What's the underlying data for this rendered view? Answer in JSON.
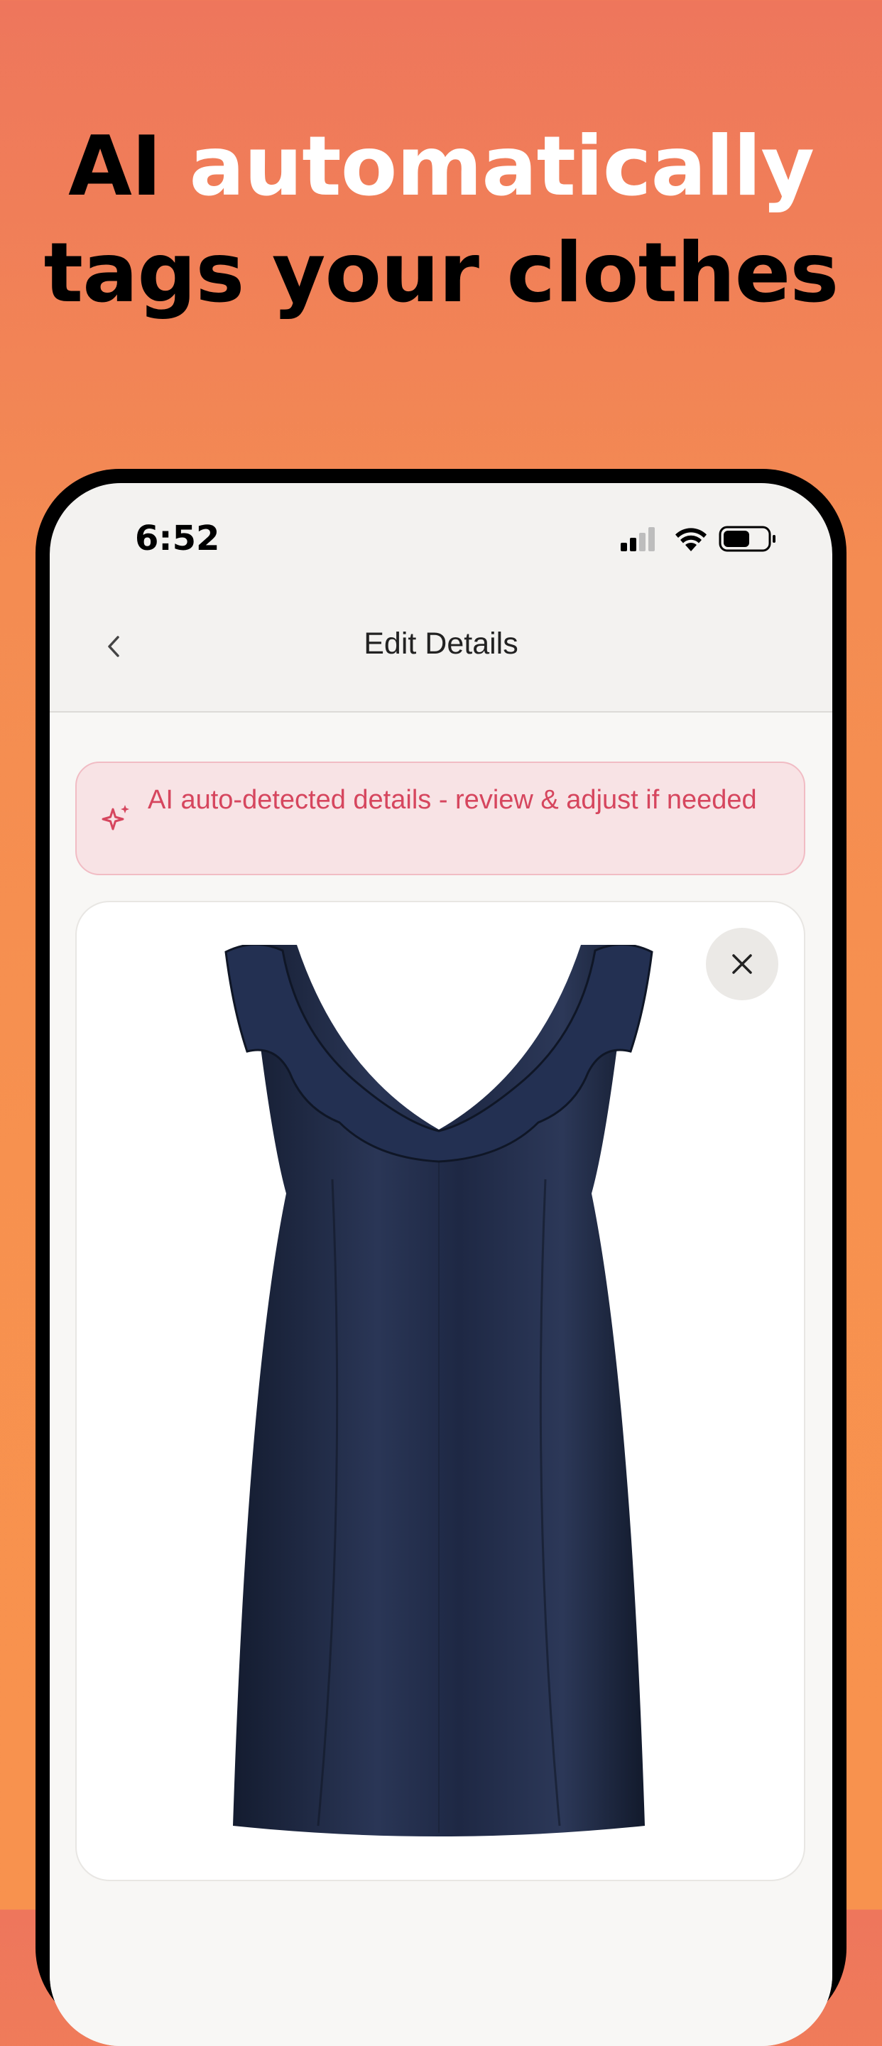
{
  "headline": {
    "part1": "AI ",
    "part2": "automatically",
    "part3": "tags your clothes"
  },
  "status_bar": {
    "time": "6:52",
    "icons": [
      "cellular-signal-icon",
      "wifi-icon",
      "battery-icon"
    ]
  },
  "nav": {
    "title": "Edit Details",
    "back_icon": "chevron-left-icon"
  },
  "banner": {
    "icon": "sparkle-icon",
    "text": "AI auto-detected details - review & adjust if needed"
  },
  "item_card": {
    "image_icon": "navy-satin-ruffle-dress",
    "close_icon": "close-icon"
  },
  "colors": {
    "background_top": "#ee765c",
    "background_bottom": "#f8924e",
    "banner_bg": "#f8e3e5",
    "banner_text": "#d6465e",
    "dress": "#1f2a44"
  }
}
